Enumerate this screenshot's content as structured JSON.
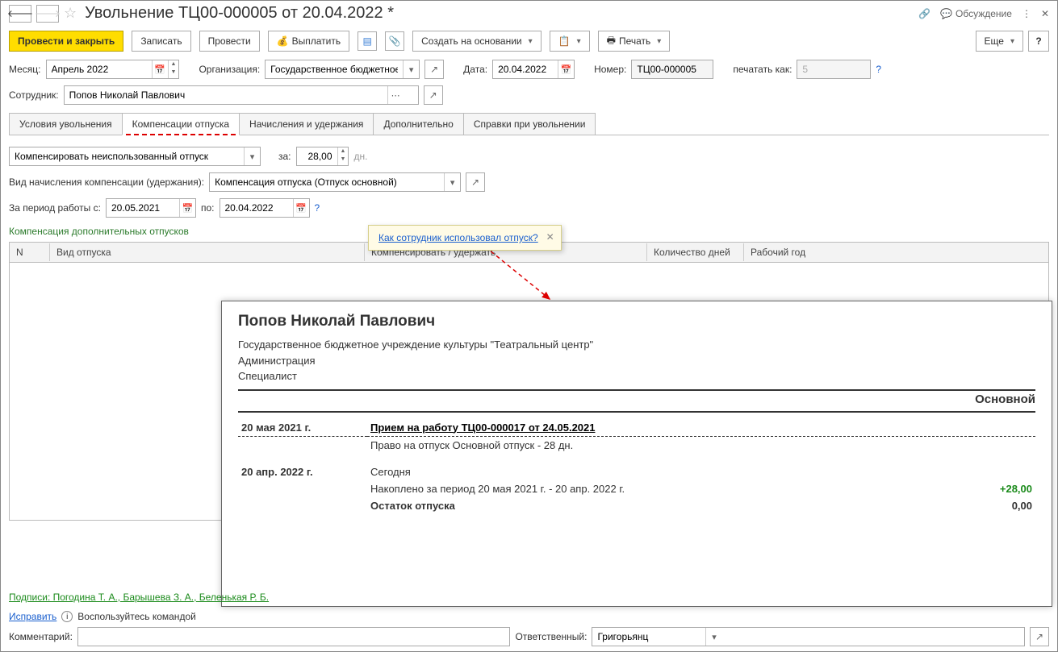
{
  "title": "Увольнение ТЦ00-000005 от 20.04.2022 *",
  "titlebar": {
    "discuss": "Обсуждение"
  },
  "toolbar": {
    "post_close": "Провести и закрыть",
    "save": "Записать",
    "post": "Провести",
    "pay": "Выплатить",
    "create_based": "Создать на основании",
    "print": "Печать",
    "more": "Еще"
  },
  "fields": {
    "month_label": "Месяц:",
    "month_value": "Апрель 2022",
    "org_label": "Организация:",
    "org_value": "Государственное бюджетное",
    "date_label": "Дата:",
    "date_value": "20.04.2022",
    "number_label": "Номер:",
    "number_value": "ТЦ00-000005",
    "print_as_label": "печатать как:",
    "print_as_value": "5",
    "employee_label": "Сотрудник:",
    "employee_value": "Попов Николай Павлович"
  },
  "tabs": {
    "t1": "Условия увольнения",
    "t2": "Компенсации отпуска",
    "t3": "Начисления и удержания",
    "t4": "Дополнительно",
    "t5": "Справки при увольнении"
  },
  "comp": {
    "type": "Компенсировать неиспользованный отпуск",
    "za": "за:",
    "days": "28,00",
    "dn": "дн.",
    "accrual_label": "Вид начисления компенсации (удержания):",
    "accrual_value": "Компенсация отпуска (Отпуск основной)",
    "period_label": "За период работы с:",
    "period_from": "20.05.2021",
    "po": "по:",
    "period_to": "20.04.2022",
    "extra_header": "Компенсация дополнительных отпусков"
  },
  "table": {
    "h1": "N",
    "h2": "Вид отпуска",
    "h3": "Компенсировать / удержать",
    "h4": "Количество дней",
    "h5": "Рабочий год"
  },
  "tooltip": {
    "text": "Как сотрудник использовал отпуск?"
  },
  "report": {
    "name": "Попов Николай Павлович",
    "org": "Государственное бюджетное учреждение культуры \"Театральный центр\"",
    "dept": "Администрация",
    "pos": "Специалист",
    "section": "Основной",
    "r1_date": "20 мая 2021 г.",
    "r1_title": "Прием на работу ТЦ00-000017 от 24.05.2021",
    "r1_desc": "Право на отпуск Основной отпуск - 28 дн.",
    "r2_date": "20 апр. 2022 г.",
    "r2_title": "Сегодня",
    "r2_desc": "Накоплено за период 20 мая 2021 г. - 20 апр. 2022 г.",
    "r2_val": "+28,00",
    "r3_desc": "Остаток отпуска",
    "r3_val": "0,00"
  },
  "signs": "Подписи: Погодина Т. А., Барышева З. А., Беленькая Р. Б.",
  "fix": {
    "link": "Исправить",
    "hint": "Воспользуйтесь командой"
  },
  "bottom": {
    "comment_label": "Комментарий:",
    "resp_label": "Ответственный:",
    "resp_value": "Григорьянц"
  }
}
